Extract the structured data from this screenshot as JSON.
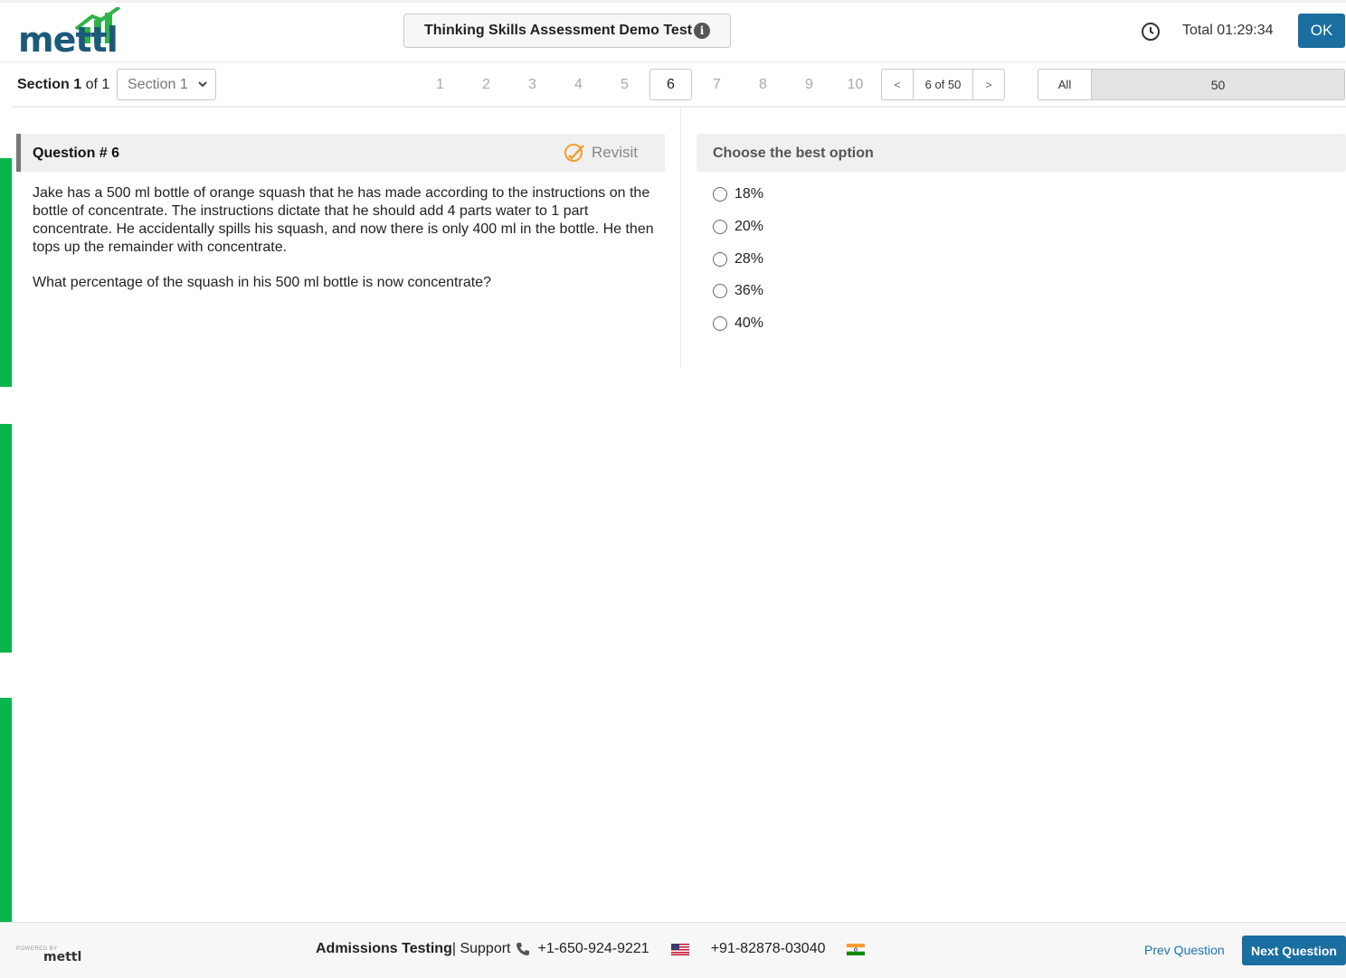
{
  "header": {
    "logo_text": "mettl",
    "test_title": "Thinking Skills Assessment Demo Test",
    "info_symbol": "i",
    "timer_label": "Total 01:29:34",
    "ok_label": "OK"
  },
  "section": {
    "label_word": "Section",
    "current": "1",
    "of_word": "of",
    "total": "1",
    "select_value": "Section 1"
  },
  "question_nav": {
    "numbers": [
      "1",
      "2",
      "3",
      "4",
      "5",
      "6",
      "7",
      "8",
      "9",
      "10"
    ],
    "active": "6",
    "prev_symbol": "<",
    "next_symbol": ">",
    "position_label": "6 of 50",
    "filter_all_label": "All",
    "filter_count": "50"
  },
  "question": {
    "title": "Question # 6",
    "revisit_label": "Revisit",
    "paragraph_1": "Jake has a 500 ml bottle of orange squash that he has made according to the instructions on the bottle of concentrate. The instructions dictate that he should add 4 parts water to 1 part concentrate. He accidentally spills his squash, and now there is only 400 ml in the bottle. He then tops up the remainder with concentrate.",
    "paragraph_2": "What percentage of the squash in his 500 ml bottle is now concentrate?"
  },
  "options": {
    "title": "Choose the best option",
    "items": [
      "18%",
      "20%",
      "28%",
      "36%",
      "40%"
    ]
  },
  "footer": {
    "powered_by": "POWERED BY",
    "powered_logo": "mettl",
    "brand": "Admissions Testing",
    "separator": " | Support",
    "phone_us": "+1-650-924-9221",
    "phone_in": "+91-82878-03040",
    "prev_label": "Prev Question",
    "next_label": "Next Question"
  },
  "colors": {
    "brand_blue": "#1a6ea0",
    "logo_blue": "#1c5a7a",
    "logo_green": "#2fb34a",
    "sidebar_green": "#0bb54b",
    "revisit_orange": "#f0a030"
  }
}
